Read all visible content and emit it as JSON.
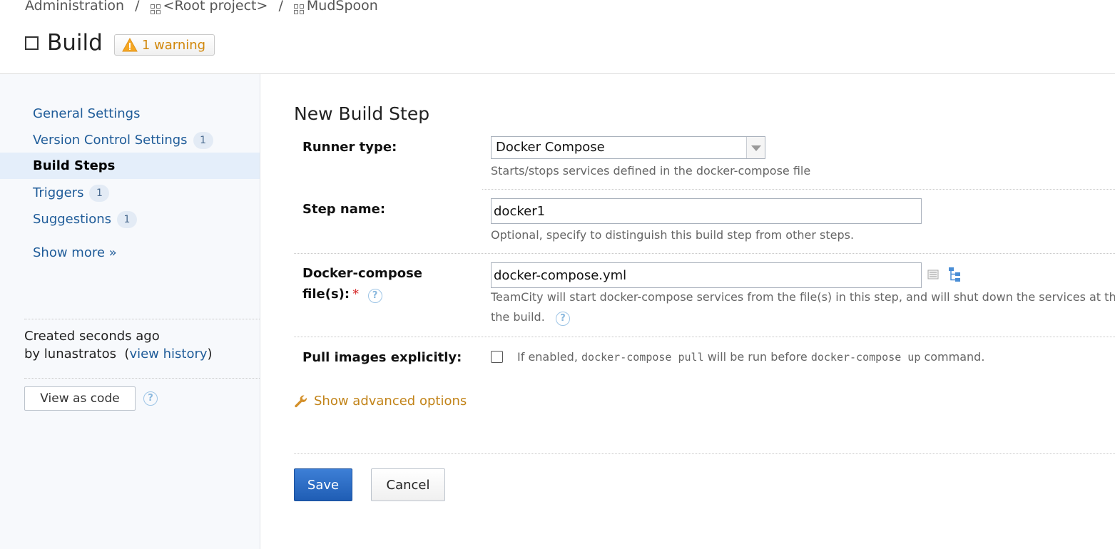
{
  "breadcrumb": {
    "items": [
      "Administration",
      "<Root project>",
      "MudSpoon"
    ],
    "separator": "/"
  },
  "header": {
    "title": "Build",
    "warning_badge": "1 warning"
  },
  "sidebar": {
    "items": [
      {
        "label": "General Settings",
        "count": ""
      },
      {
        "label": "Version Control Settings",
        "count": "1"
      },
      {
        "label": "Build Steps",
        "count": "",
        "active": true
      },
      {
        "label": "Triggers",
        "count": "1"
      },
      {
        "label": "Suggestions",
        "count": "1"
      }
    ],
    "show_more": "Show more »",
    "created": "Created seconds ago",
    "created_by": "by lunastratos",
    "view_history": "view history",
    "view_as_code": "View as code"
  },
  "form": {
    "title": "New Build Step",
    "runner_type_label": "Runner type:",
    "runner_type_value": "Docker Compose",
    "runner_type_hint": "Starts/stops services defined in the docker-compose file",
    "step_name_label": "Step name:",
    "step_name_value": "docker1",
    "step_name_hint": "Optional, specify to distinguish this build step from other steps.",
    "compose_label_1": "Docker-compose",
    "compose_label_2": "file(s):",
    "compose_required": "*",
    "compose_value": "docker-compose.yml",
    "compose_hint_1": "TeamCity will start docker-compose services from the file(s) in this step, and will shut down the services at th",
    "compose_hint_2": "the build.",
    "pull_label": "Pull images explicitly:",
    "pull_hint_pre": "If enabled,",
    "pull_hint_code1": "docker-compose pull",
    "pull_hint_mid": "will be run before",
    "pull_hint_code2": "docker-compose up",
    "pull_hint_post": "command.",
    "advanced": "Show advanced options",
    "save": "Save",
    "cancel": "Cancel"
  },
  "colors": {
    "link": "#1f5c99",
    "warning": "#d1870a",
    "primary_button": "#2a6cc4",
    "advanced_link": "#c2841a",
    "sidebar_active_bg": "#e4eefa"
  }
}
